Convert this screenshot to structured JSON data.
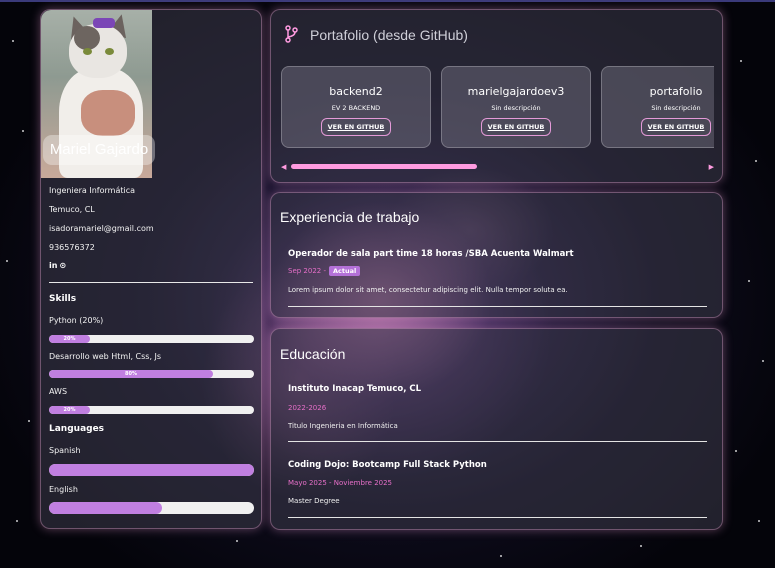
{
  "profile": {
    "name": "Mariel Gajardo",
    "title": "Ingeniera Informática",
    "location": "Temuco, CL",
    "email": "isadoramariel@gmail.com",
    "phone": "936576372",
    "social_linkedin": "in",
    "social_github": "⊙"
  },
  "skills": {
    "heading": "Skills",
    "items": [
      {
        "label": "Python (20%)",
        "percent": 20,
        "bar_text": "20%"
      },
      {
        "label": "Desarrollo web Html, Css, Js",
        "percent": 80,
        "bar_text": "80%"
      },
      {
        "label": "AWS",
        "percent": 20,
        "bar_text": "20%"
      }
    ]
  },
  "languages": {
    "heading": "Languages",
    "items": [
      {
        "label": "Spanish",
        "percent": 100
      },
      {
        "label": "English",
        "percent": 55
      }
    ]
  },
  "portfolio": {
    "title": "Portafolio (desde GitHub)",
    "repos": [
      {
        "name": "backend2",
        "description": "EV 2 BACKEND",
        "button": "VER EN GITHUB"
      },
      {
        "name": "marielgajardoev3",
        "description": "Sin descripción",
        "button": "VER EN GITHUB"
      },
      {
        "name": "portafolio",
        "description": "Sin descripción",
        "button": "VER EN GITHUB"
      }
    ],
    "scroll_position": 0.42
  },
  "experience": {
    "title": "Experiencia de trabajo",
    "jobs": [
      {
        "title": "Operador de sala part time 18 horas /SBA Acuenta Walmart",
        "date": "Sep 2022 -",
        "badge": "Actual",
        "description": "Lorem ipsum dolor sit amet, consectetur adipiscing elit. Nulla tempor soluta ea."
      }
    ]
  },
  "education": {
    "title": "Educación",
    "items": [
      {
        "school": "Instituto Inacap Temuco, CL",
        "date": "2022-2026",
        "degree": "Titulo Ingenieria en Informática"
      },
      {
        "school": "Coding Dojo: Bootcamp Full Stack Python",
        "date": "Mayo 2025 - Noviembre 2025",
        "degree": "Master Degree"
      }
    ]
  },
  "colors": {
    "accent": "#c07fe0",
    "pink": "#e66fc8",
    "border_glow": "#ff9be0"
  }
}
